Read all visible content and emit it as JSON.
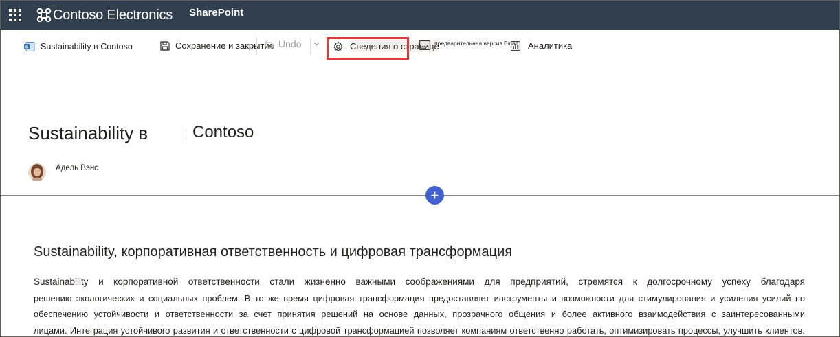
{
  "suitebar": {
    "brand": "Contoso Electronics",
    "product": "SharePoint"
  },
  "commandbar": {
    "site_label": "Sustainability в Contoso",
    "save_label": "Сохранение и закрытие",
    "undo_label": "Undo",
    "page_details_label": "Сведения о странице",
    "preview_label": "предварительная версия",
    "preview_icon_text": "Email",
    "analytics_label": "Аналитика"
  },
  "page": {
    "title_part1": "Sustainability в",
    "title_part2": "Contoso",
    "author": "Адель Вэнс"
  },
  "content": {
    "heading": "Sustainability, корпоративная ответственность и цифровая трансформация",
    "lines": [
      "Sustainability и корпоративной ответственности стали жизненно важными соображениями для предприятий, стремятся к долгосрочному успеху благодаря",
      "решению экологических и социальных проблем. В то же время цифровая трансформация предоставляет инструменты и возможности для стимулирования и усиления усилий по",
      "обеспечению устойчивости и ответственности за счет принятия решений на основе данных, прозрачного общения и более активного взаимодействия с заинтересованными",
      "лицами. Интеграция устойчивого развития и ответственности с цифровой трансформацией позволяет компаниям ответственно работать, оптимизировать процессы, улучшить клиентов."
    ]
  },
  "colors": {
    "suitebar_bg": "#323f4e",
    "accent": "#4262cf",
    "highlight": "#e03a3a"
  },
  "icons": [
    "waffle-icon",
    "contoso-logo-icon",
    "sharepoint-site-icon",
    "save-icon",
    "undo-icon",
    "chevron-down-icon",
    "gear-icon",
    "preview-icon",
    "analytics-icon",
    "plus-icon"
  ]
}
